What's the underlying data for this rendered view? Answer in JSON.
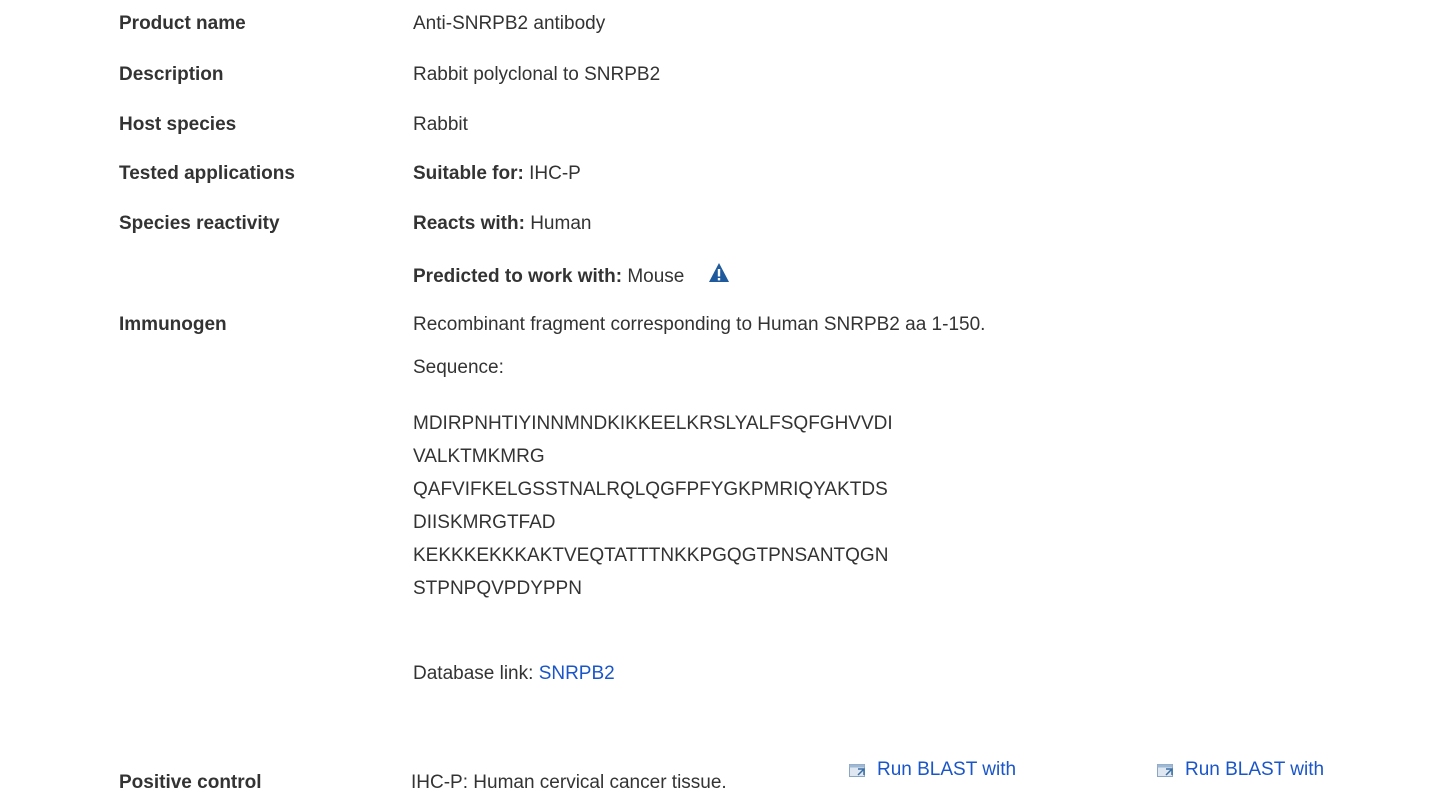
{
  "rows": {
    "product_name": {
      "label": "Product name",
      "value": "Anti-SNRPB2 antibody"
    },
    "description": {
      "label": "Description",
      "value": "Rabbit polyclonal to SNRPB2"
    },
    "host_species": {
      "label": "Host species",
      "value": "Rabbit"
    },
    "tested_applications": {
      "label": "Tested applications",
      "prefix": "Suitable for:",
      "value": "IHC-P"
    },
    "species_reactivity": {
      "label": "Species reactivity",
      "reacts_prefix": "Reacts with:",
      "reacts_value": "Human",
      "predicted_prefix": "Predicted to work with:",
      "predicted_value": "Mouse"
    },
    "immunogen": {
      "label": "Immunogen",
      "description": "Recombinant fragment corresponding to Human SNRPB2 aa 1-150.",
      "sequence_label": "Sequence:",
      "sequence_lines": [
        "MDIRPNHTIYINNMNDKIKKEELKRSLYALFSQFGHVVDI",
        "VALKTMKMRG",
        "QAFVIFKELGSSTNALRQLQGFPFYGKPMRIQYAKTDS",
        "DIISKMRGTFAD",
        "KEKKKEKKKAKTVEQTATTTNKKPGQGTPNSANTQGN",
        "STPNPQVPDYPPN"
      ],
      "database_link_label": "Database link:",
      "database_link_text": "SNRPB2",
      "blast_links": [
        "Run BLAST with",
        "Run BLAST with"
      ]
    },
    "positive_control": {
      "label": "Positive control",
      "value": "IHC-P: Human cervical cancer tissue."
    }
  },
  "colors": {
    "link": "#1a56c9",
    "text": "#333333",
    "warning": "#1e5a9c"
  },
  "icons": {
    "warning": "warning-triangle-icon",
    "external": "external-link-icon"
  }
}
